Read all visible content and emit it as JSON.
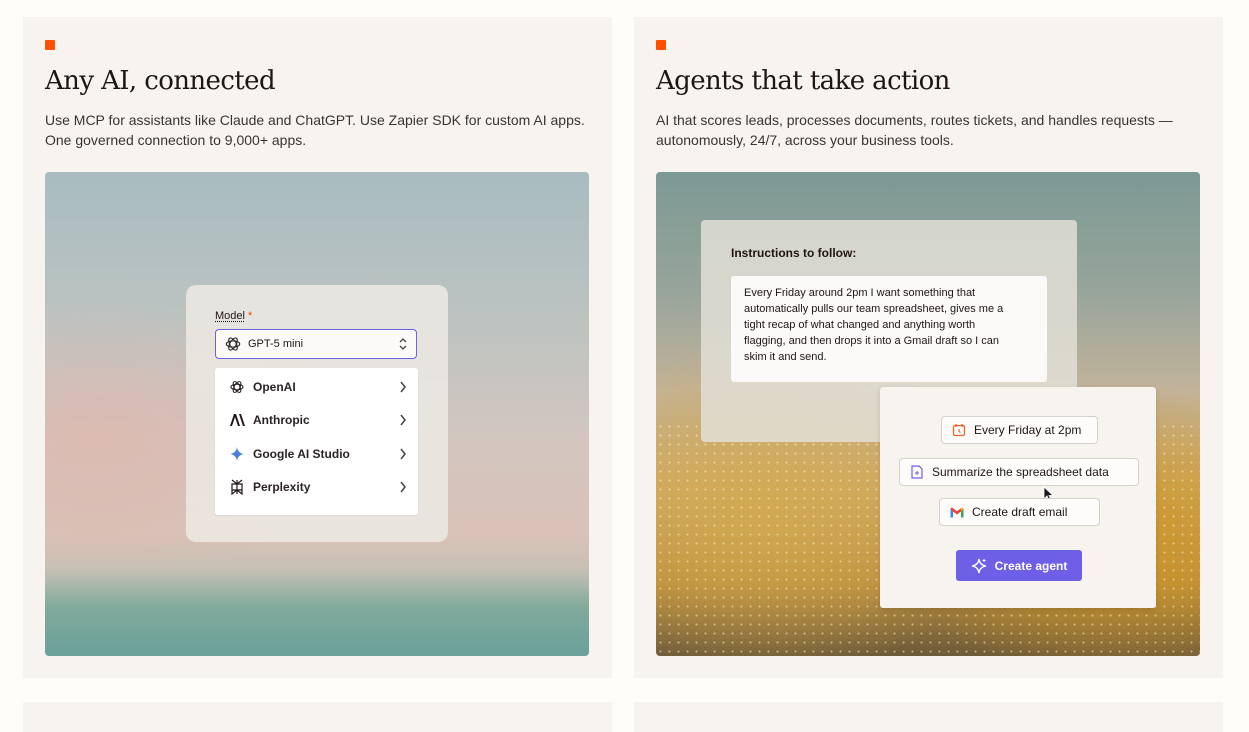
{
  "cards": [
    {
      "title": "Any AI, connected",
      "description_lines": [
        "Use MCP for assistants like Claude and ChatGPT. Use Zapier SDK for custom AI apps.",
        "One governed connection to 9,000+ apps."
      ],
      "model_picker": {
        "label": "Model",
        "required_mark": "*",
        "selected": "GPT-5 mini",
        "providers": [
          {
            "label": "OpenAI",
            "icon": "openai-icon"
          },
          {
            "label": "Anthropic",
            "icon": "anthropic-icon"
          },
          {
            "label": "Google AI Studio",
            "icon": "google-ai-studio-icon"
          },
          {
            "label": "Perplexity",
            "icon": "perplexity-icon"
          }
        ]
      }
    },
    {
      "title": "Agents that take action",
      "description_lines": [
        "AI that scores leads, processes documents, routes tickets, and handles requests —",
        "autonomously, 24/7, across your business tools."
      ],
      "instructions": {
        "title": "Instructions to follow:",
        "text_lines": [
          "Every Friday around 2pm I want something that",
          "automatically pulls our team spreadsheet, gives me a",
          "tight recap of what changed and anything worth",
          "flagging, and then drops it into a Gmail draft so I can",
          "skim it and send."
        ]
      },
      "actions": [
        {
          "label": "Every Friday at 2pm",
          "icon": "calendar-icon"
        },
        {
          "label": "Summarize the spreadsheet data",
          "icon": "document-icon"
        },
        {
          "label": "Create draft email",
          "icon": "gmail-icon"
        }
      ],
      "create_button": "Create agent"
    }
  ],
  "colors": {
    "accent": "#ff4f00",
    "button": "#6d5fe6",
    "select_border": "#6d63e0",
    "card_bg": "#f7f4ef"
  }
}
